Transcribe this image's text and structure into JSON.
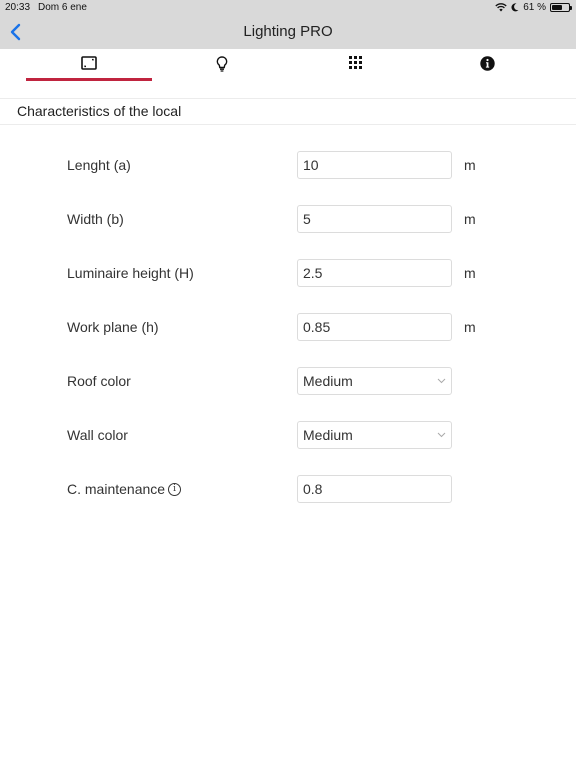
{
  "status_bar": {
    "time": "20:33",
    "date": "Dom 6 ene",
    "battery": "61 %",
    "battery_level": 0.61
  },
  "nav": {
    "title": "Lighting PRO"
  },
  "tabs": [
    {
      "icon": "room-dimensions-icon",
      "active": true
    },
    {
      "icon": "lightbulb-icon",
      "active": false
    },
    {
      "icon": "grid-icon",
      "active": false
    },
    {
      "icon": "info-icon",
      "active": false
    }
  ],
  "section": {
    "title": "Characteristics of the local"
  },
  "form": {
    "length": {
      "label": "Lenght (a)",
      "value": "10",
      "unit": "m"
    },
    "width": {
      "label": "Width (b)",
      "value": "5",
      "unit": "m"
    },
    "luminaire_height": {
      "label": "Luminaire height (H)",
      "value": "2.5",
      "unit": "m"
    },
    "work_plane": {
      "label": "Work plane (h)",
      "value": "0.85",
      "unit": "m"
    },
    "roof_color": {
      "label": "Roof color",
      "value": "Medium"
    },
    "wall_color": {
      "label": "Wall color",
      "value": "Medium"
    },
    "maintenance": {
      "label": "C. maintenance",
      "value": "0.8"
    }
  },
  "colors": {
    "accent": "#c0243f",
    "back": "#1a73e8",
    "bar": "#d9d9d9"
  }
}
